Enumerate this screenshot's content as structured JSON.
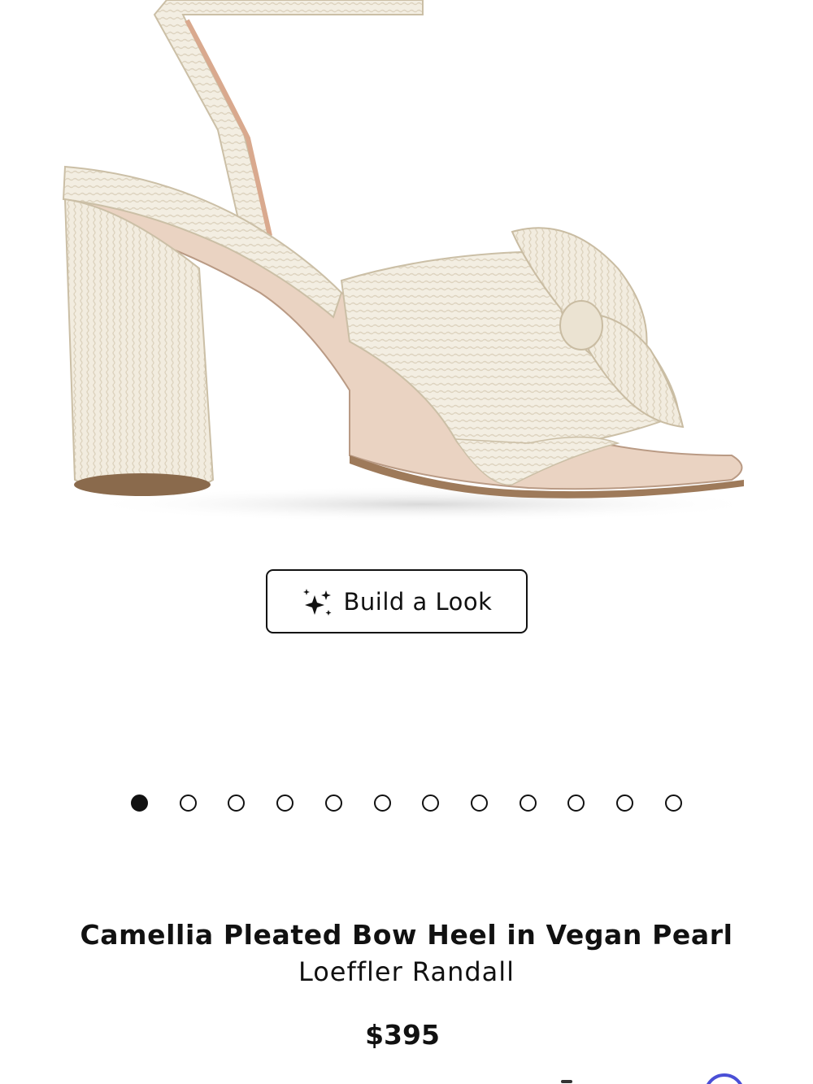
{
  "product": {
    "image_alt": "Camellia Pleated Bow Heel in Vegan Pearl",
    "title": "Camellia Pleated Bow Heel in Vegan Pearl",
    "brand": "Loeffler Randall",
    "price": "$395"
  },
  "actions": {
    "build_look_label": "Build a Look",
    "build_look_icon": "sparkle-icon"
  },
  "carousel": {
    "total": 12,
    "active_index": 0
  },
  "colors": {
    "text": "#111111",
    "background": "#ffffff",
    "accent_ring": "#4a4fd6"
  }
}
